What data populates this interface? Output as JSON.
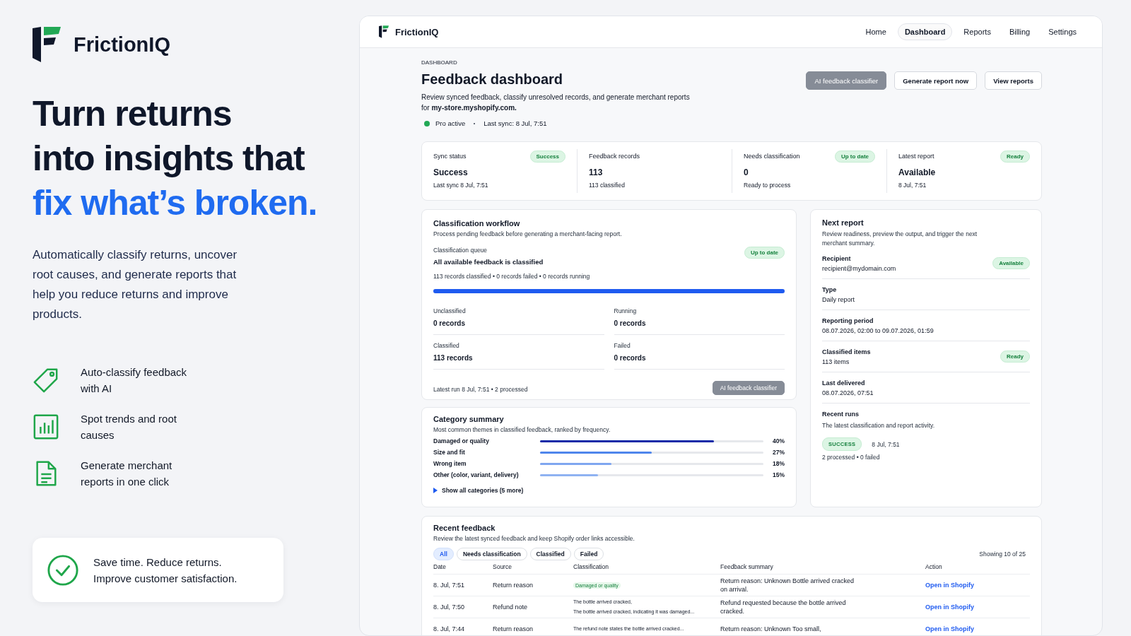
{
  "brand": {
    "name": "FrictionIQ"
  },
  "hero": {
    "headline_lines": [
      "Turn returns",
      "into insights that"
    ],
    "headline_accent": "fix what’s broken.",
    "description": "Automatically classify returns, uncover root causes, and generate reports that help you reduce returns and improve products."
  },
  "features": [
    {
      "kind": "tag",
      "text": "Auto-classify feedback with AI"
    },
    {
      "kind": "chart",
      "text": "Spot trends and root causes"
    },
    {
      "kind": "document",
      "text": "Generate merchant reports in one click"
    }
  ],
  "callout": {
    "text": "Save time. Reduce returns. Improve customer satisfaction."
  },
  "app": {
    "brand": "FrictionIQ",
    "nav": [
      {
        "label": "Home",
        "selected": false
      },
      {
        "label": "Dashboard",
        "selected": true
      },
      {
        "label": "Reports",
        "selected": false
      },
      {
        "label": "Billing",
        "selected": false
      },
      {
        "label": "Settings",
        "selected": false
      }
    ],
    "eyebrow": "DASHBOARD",
    "title": "Feedback dashboard",
    "description": "Review synced feedback, classify unresolved records, and generate merchant reports for **my-store.myshopify.com.**",
    "plan": {
      "text": "Pro active",
      "active": true
    },
    "last_sync": "Last sync: 8 Jul, 7:51",
    "actions": [
      {
        "label": "AI feedback classifier",
        "disabled": true
      },
      {
        "label": "Generate report now",
        "disabled": false
      },
      {
        "label": "View reports",
        "disabled": false
      }
    ],
    "stats": [
      {
        "label": "Sync status",
        "badge": "Success",
        "value": "Success",
        "sub": "Last sync 8 Jul, 7:51"
      },
      {
        "label": "Feedback records",
        "value": "113",
        "sub": "113 classified"
      },
      {
        "label": "Needs classification",
        "badge": "Up to date",
        "value": "0",
        "sub": "Ready to process"
      },
      {
        "label": "Latest report",
        "badge": "Ready",
        "value": "Available",
        "sub": "8 Jul, 7:51"
      }
    ],
    "workflow": {
      "title": "Classification workflow",
      "description": "Process pending feedback before generating a merchant-facing report.",
      "queue_label": "Classification queue",
      "queue_status": "All available feedback is classified",
      "badge": "Up to date",
      "counts": "113 records classified  • 0 records failed • 0 records running",
      "level": 1,
      "cells": [
        {
          "label": "Unclassified",
          "value": "0 records"
        },
        {
          "label": "Running",
          "value": "0 records"
        },
        {
          "label": "Classified",
          "value": "113 records"
        },
        {
          "label": "Failed",
          "value": "0 records"
        }
      ],
      "latest_run": "Latest run 8 Jul, 7:51  •  2 processed",
      "button": {
        "label": "AI feedback classifier",
        "disabled": true
      }
    },
    "categories": {
      "title": "Category summary",
      "description": "Most common themes in classified feedback, ranked by frequency.",
      "items": [
        {
          "name": "Damaged or quality",
          "level": 0.78,
          "color": "#0f2aa8",
          "percent": "40%"
        },
        {
          "name": "Size and fit",
          "level": 0.5,
          "color": "#4f86ec",
          "percent": "27%"
        },
        {
          "name": "Wrong item",
          "level": 0.32,
          "color": "#7fa6f0",
          "percent": "18%"
        },
        {
          "name": "Other (color, variant, delivery)",
          "level": 0.26,
          "color": "#8fb2f2",
          "percent": "15%"
        }
      ],
      "toggle": {
        "label": "Show all categories (5 more)",
        "expanded": false
      }
    },
    "next_report": {
      "title": "Next report",
      "description": "Review readiness, preview the output, and trigger the next merchant summary.",
      "fields": [
        {
          "label": "Recipient",
          "value": "recipient@mydomain.com",
          "badge": "Available"
        },
        {
          "label": "Type",
          "value": "Daily report"
        },
        {
          "label": "Reporting period",
          "value": "08.07.2026, 02:00 to 09.07.2026, 01:59"
        },
        {
          "label": "Classified items",
          "value": "113 items",
          "badge": "Ready"
        },
        {
          "label": "Last delivered",
          "value": "08.07.2026, 07:51"
        }
      ],
      "runs_title": "Recent runs",
      "runs_description": "The latest classification and report activity.",
      "run": {
        "status": "SUCCESS",
        "time": "8 Jul, 7:51",
        "detail": "2 processed  •  0 failed"
      }
    },
    "recent": {
      "title": "Recent feedback",
      "description": "Review the latest synced feedback and keep Shopify order links accessible.",
      "filters": [
        {
          "label": "All",
          "selected": true
        },
        {
          "label": "Needs classification",
          "selected": false
        },
        {
          "label": "Classified",
          "selected": false
        },
        {
          "label": "Failed",
          "selected": false
        }
      ],
      "count": "Showing 10 of 25",
      "columns": [
        "Date",
        "Source",
        "Classification",
        "Feedback summary",
        "Action"
      ],
      "rows": [
        {
          "date": "8. Jul, 7:51",
          "source": "Return reason",
          "classification": {
            "kind": "tag",
            "lines": [
              "Damaged or quality"
            ]
          },
          "summary": "Return reason: Unknown Bottle arrived cracked on arrival.",
          "action": "Open in Shopify"
        },
        {
          "date": "8. Jul, 7:50",
          "source": "Refund note",
          "classification": {
            "kind": "text",
            "lines": [
              "The bottle arrived cracked,",
              "The bottle arrived cracked, indicating it was damaged..."
            ]
          },
          "summary": "Refund requested because the bottle arrived cracked.",
          "action": "Open in Shopify"
        },
        {
          "date": "8. Jul, 7:44",
          "source": "Return reason",
          "classification": {
            "kind": "text",
            "lines": [
              "The refund note states the bottle arrived cracked..."
            ]
          },
          "summary": "Return reason: Unknown Too small,",
          "action": "Open in Shopify"
        }
      ]
    }
  }
}
